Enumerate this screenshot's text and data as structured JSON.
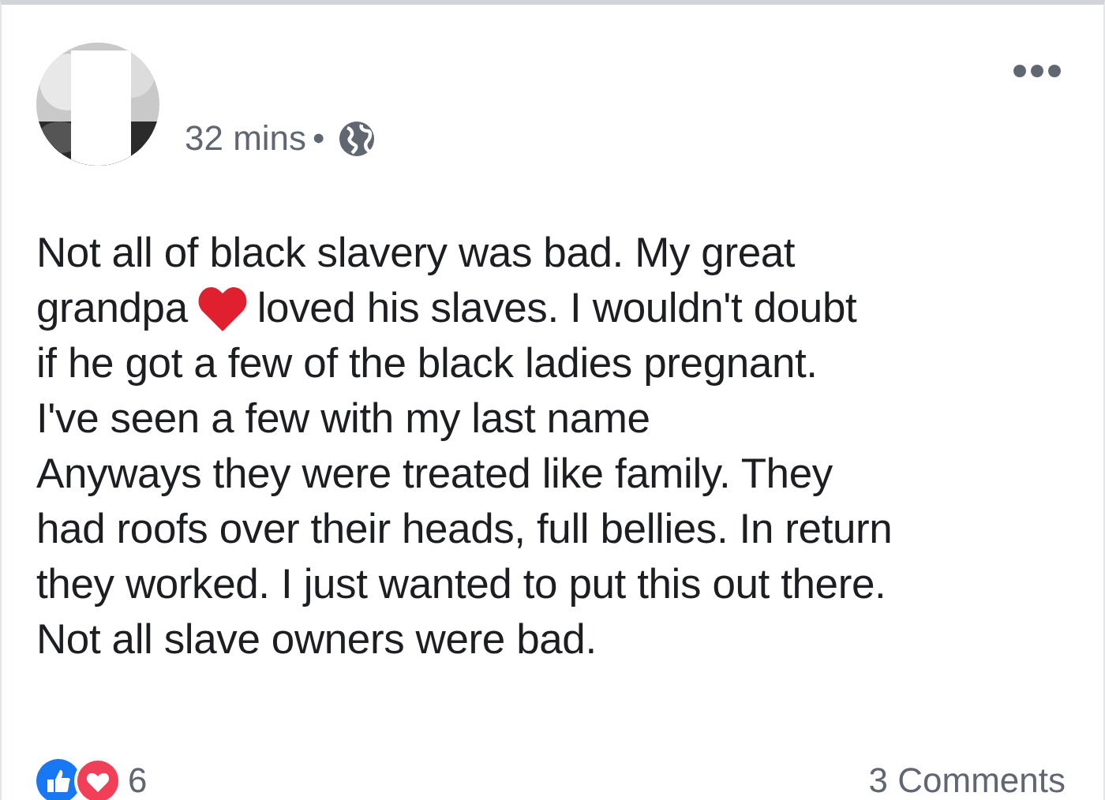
{
  "post": {
    "time": "32 mins",
    "separator": "•",
    "lines": [
      {
        "kind": "text",
        "text": "Not all of black slavery was bad.  My great"
      },
      {
        "kind": "heart",
        "before": "grandpa",
        "after": "loved his slaves.  I wouldn't doubt"
      },
      {
        "kind": "text",
        "text": "if he got a few of the black ladies pregnant."
      },
      {
        "kind": "text",
        "text": "I've seen a few with my last name"
      },
      {
        "kind": "text",
        "text": "Anyways they were treated like family.  They"
      },
      {
        "kind": "text",
        "text": "had roofs over their heads, full bellies.  In return"
      },
      {
        "kind": "text",
        "text": "they worked.  I just wanted to put this out there."
      },
      {
        "kind": "text",
        "text": "Not all slave owners were bad."
      }
    ],
    "reaction_count": "6",
    "comments": "3 Comments"
  }
}
